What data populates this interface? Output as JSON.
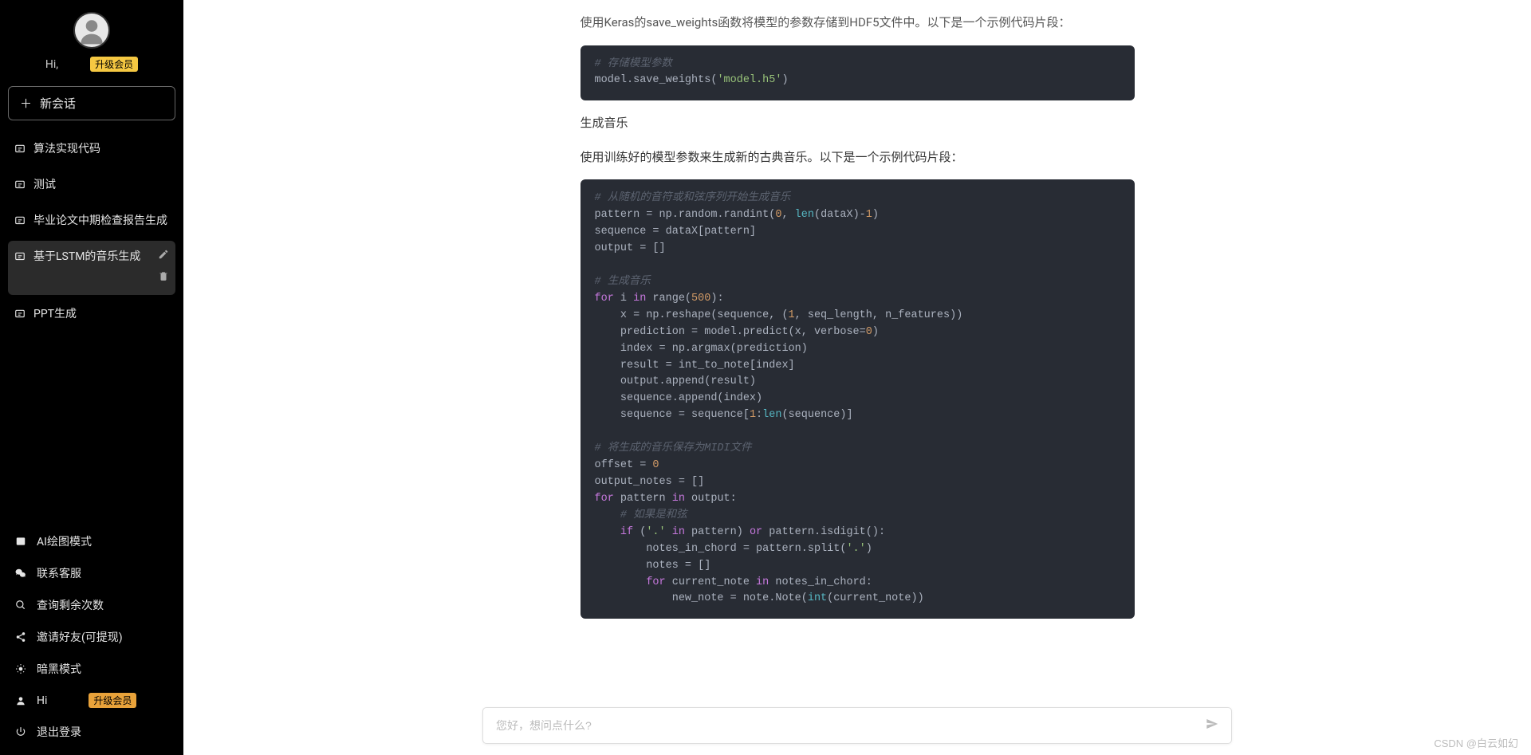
{
  "sidebar": {
    "greeting_prefix": "Hi,",
    "badge_upgrade": "升级会员",
    "new_chat": "新会话",
    "convos": [
      {
        "label": "算法实现代码"
      },
      {
        "label": "测试"
      },
      {
        "label": "毕业论文中期检查报告生成"
      },
      {
        "label": "基于LSTM的音乐生成",
        "active": true
      },
      {
        "label": "PPT生成"
      }
    ],
    "tools": {
      "ai_draw": "AI绘图模式",
      "contact": "联系客服",
      "query_remain": "查询剩余次数",
      "invite": "邀请好友(可提现)",
      "dark_mode": "暗黑模式",
      "user_row_prefix": "Hi ",
      "logout": "退出登录"
    }
  },
  "article": {
    "p_top_partial": "使用Keras的save_weights函数将模型的参数存储到HDF5文件中。以下是一个示例代码片段：",
    "code1": {
      "c1": "# 存储模型参数",
      "l1a": "model.save_weights(",
      "l1s": "'model.h5'",
      "l1b": ")"
    },
    "h_gen": "生成音乐",
    "p_gen_desc": "使用训练好的模型参数来生成新的古典音乐。以下是一个示例代码片段：",
    "code2": {
      "c1": "# 从随机的音符或和弦序列开始生成音乐",
      "l1": "pattern = np.random.randint(",
      "n0": "0",
      "l1b": ", ",
      "kw_len": "len",
      "l1c": "(dataX)-",
      "n1": "1",
      "l1d": ")",
      "l2": "sequence = dataX[pattern]",
      "l3": "output = []",
      "c2": "# 生成音乐",
      "kw_for": "for",
      "l4a": " i ",
      "kw_in": "in",
      "l4b": " range(",
      "n500": "500",
      "l4c": "):",
      "l5a": "    x = np.reshape(sequence, (",
      "l5b": ", seq_length, n_features))",
      "l6a": "    prediction = model.predict(x, verbose=",
      "l6b": ")",
      "l7": "    index = np.argmax(prediction)",
      "l8": "    result = int_to_note[index]",
      "l9": "    output.append(result)",
      "l10": "    sequence.append(index)",
      "l11a": "    sequence = sequence[",
      "l11b": ":",
      "l11c": "(sequence)]",
      "c3": "# 将生成的音乐保存为MIDI文件",
      "l12a": "offset = ",
      "l13": "output_notes = []",
      "l14a": " pattern ",
      "l14b": " output:",
      "c4": "    # 如果是和弦",
      "kw_if": "if",
      "l15a": " (",
      "s_dot": "'.'",
      "l15b": " pattern) ",
      "kw_or": "or",
      "l15c": " pattern.isdigit():",
      "l16a": "        notes_in_chord = pattern.split(",
      "l16b": ")",
      "l17": "        notes = []",
      "l18a": " current_note ",
      "l18b": " notes_in_chord:",
      "l19a": "            new_note = note.Note(",
      "kw_int": "int",
      "l19b": "(current_note))"
    }
  },
  "input": {
    "placeholder": "您好，想问点什么?"
  },
  "watermark": "CSDN @白云如幻"
}
